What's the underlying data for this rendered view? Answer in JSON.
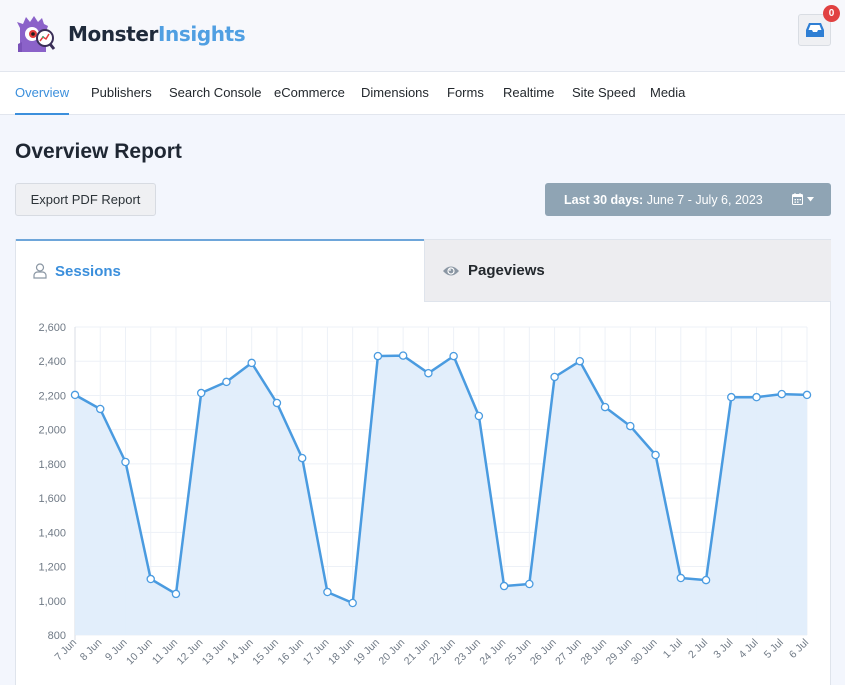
{
  "header": {
    "logo_part1": "Monster",
    "logo_part2": "Insights",
    "notifications_count": "0"
  },
  "nav": {
    "items": [
      {
        "label": "Overview",
        "active": true
      },
      {
        "label": "Publishers"
      },
      {
        "label": "Search Console"
      },
      {
        "label": "eCommerce"
      },
      {
        "label": "Dimensions"
      },
      {
        "label": "Forms"
      },
      {
        "label": "Realtime"
      },
      {
        "label": "Site Speed"
      },
      {
        "label": "Media"
      }
    ]
  },
  "page": {
    "title": "Overview Report",
    "export_label": "Export PDF Report",
    "date_range_prefix": "Last 30 days:",
    "date_range_value": "June 7 - July 6, 2023"
  },
  "tabs": {
    "sessions": "Sessions",
    "pageviews": "Pageviews"
  },
  "colors": {
    "accent": "#3b8fdc",
    "line": "#4a9be0",
    "fill": "#e0edfb",
    "grid": "#edf1f7"
  },
  "chart_data": {
    "type": "area",
    "title": "",
    "xlabel": "",
    "ylabel": "",
    "ylim": [
      800,
      2600
    ],
    "yticks": [
      "2,600",
      "2,400",
      "2,200",
      "2,000",
      "1,800",
      "1,600",
      "1,400",
      "1,200",
      "1,000",
      "800"
    ],
    "ytick_values": [
      2600,
      2400,
      2200,
      2000,
      1800,
      1600,
      1400,
      1200,
      1000,
      800
    ],
    "grid": true,
    "categories": [
      "7 Jun",
      "8 Jun",
      "9 Jun",
      "10 Jun",
      "11 Jun",
      "12 Jun",
      "13 Jun",
      "14 Jun",
      "15 Jun",
      "16 Jun",
      "17 Jun",
      "18 Jun",
      "19 Jun",
      "20 Jun",
      "21 Jun",
      "22 Jun",
      "23 Jun",
      "24 Jun",
      "25 Jun",
      "26 Jun",
      "27 Jun",
      "28 Jun",
      "29 Jun",
      "30 Jun",
      "1 Jul",
      "2 Jul",
      "3 Jul",
      "4 Jul",
      "5 Jul",
      "6 Jul"
    ],
    "series": [
      {
        "name": "Sessions",
        "values": [
          2203,
          2121,
          1811,
          1127,
          1040,
          2214,
          2279,
          2390,
          2156,
          1834,
          1051,
          987,
          2430,
          2433,
          2330,
          2430,
          2080,
          1086,
          1098,
          2308,
          2400,
          2132,
          2021,
          1852,
          1133,
          1121,
          2190,
          2190,
          2208,
          2203
        ]
      }
    ]
  }
}
